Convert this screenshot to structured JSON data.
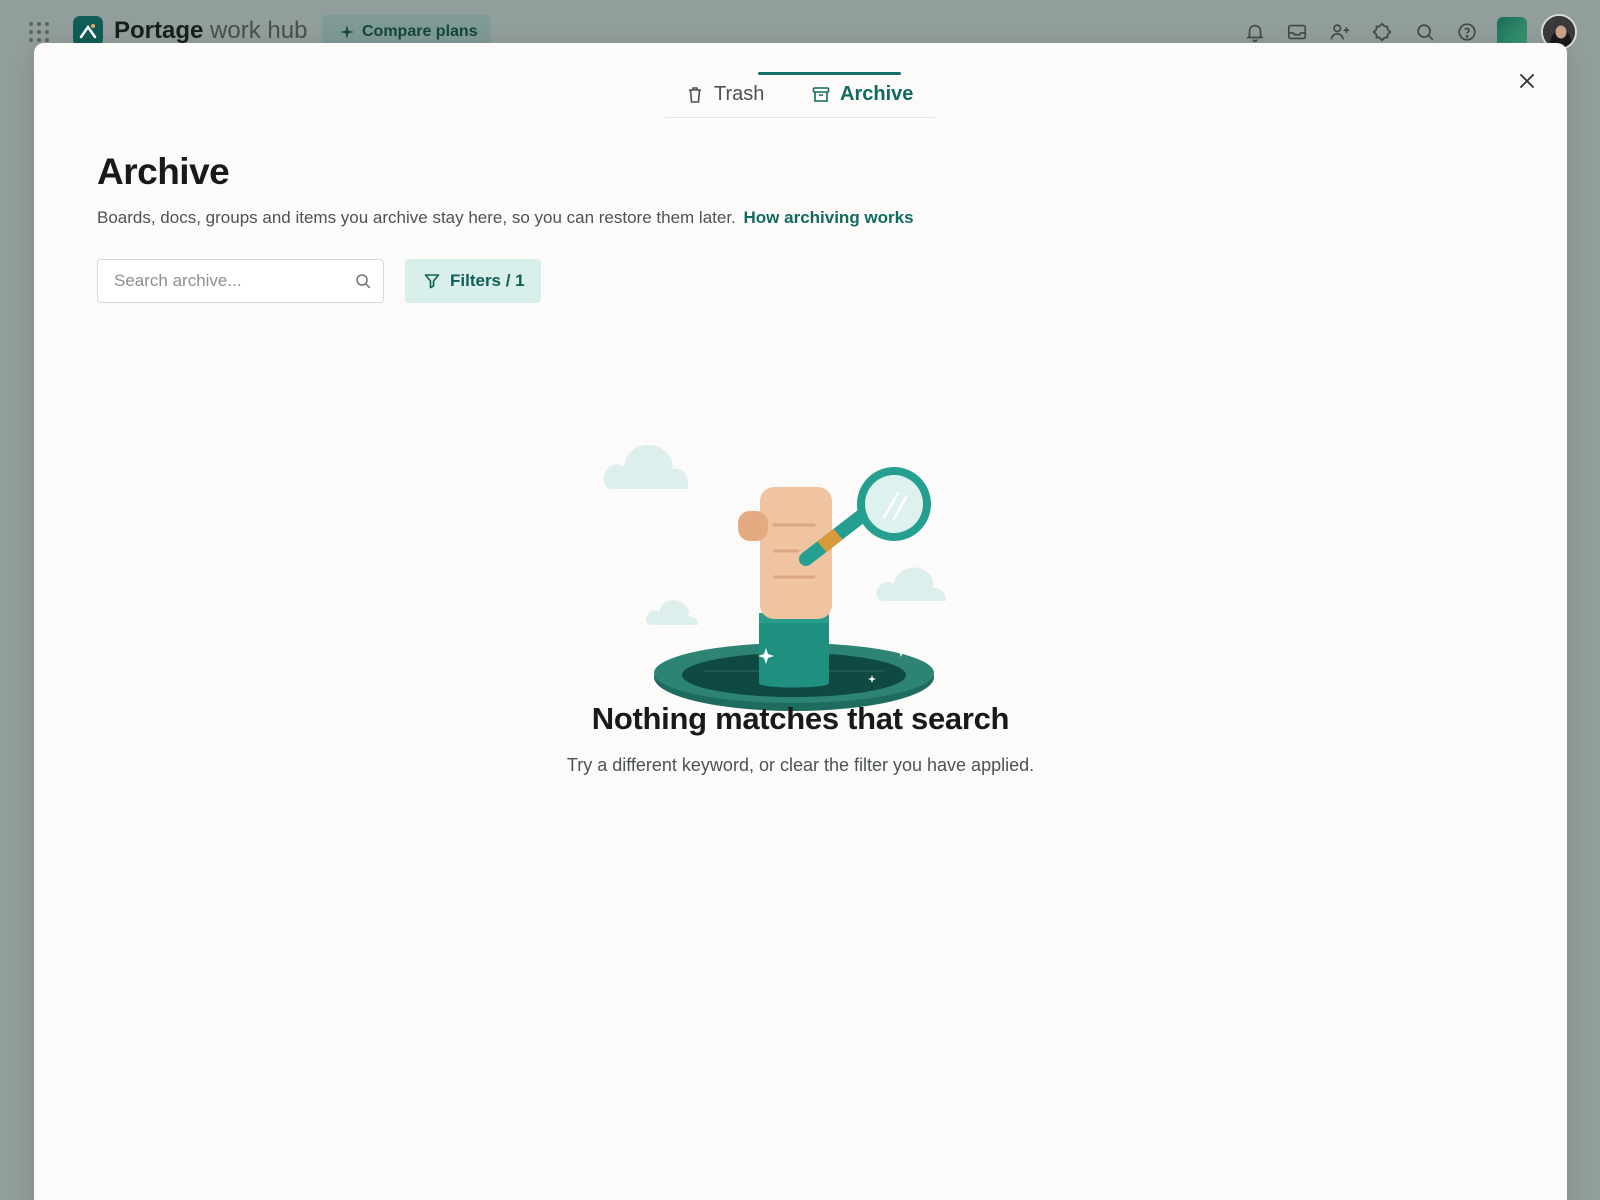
{
  "topbar": {
    "brand_bold": "Portage",
    "brand_light": "work hub",
    "compare_label": "Compare plans"
  },
  "modal": {
    "tabs": [
      {
        "label": "Trash",
        "icon": "trash-icon",
        "active": false
      },
      {
        "label": "Archive",
        "icon": "archive-icon",
        "active": true
      }
    ],
    "title": "Archive",
    "subtitle": "Boards, docs, groups and items you archive stay here, so you can restore them later.",
    "help_link": "How archiving works",
    "search": {
      "placeholder": "Search archive..."
    },
    "filters_label": "Filters / 1",
    "empty_state": {
      "title": "Nothing matches that search",
      "description": "Try a different keyword, or clear the filter you have applied."
    }
  },
  "colors": {
    "accent": "#116a60",
    "filter_bg": "#d8efeb",
    "backdrop": "#929e9c",
    "modal_bg": "#fcfbf9"
  }
}
